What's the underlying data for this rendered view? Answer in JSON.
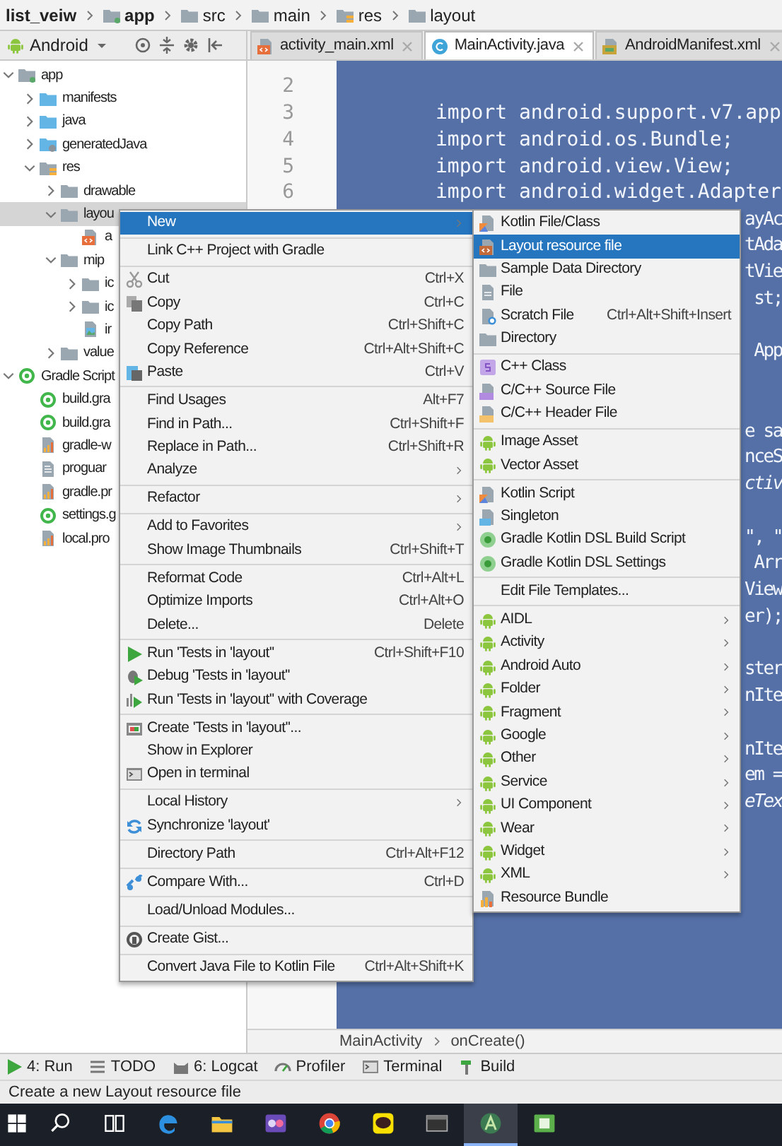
{
  "breadcrumb": [
    {
      "label": "list_veiw",
      "bold": true
    },
    {
      "label": "app",
      "bold": true,
      "kind": "module"
    },
    {
      "label": "src",
      "bold": false,
      "kind": "folder"
    },
    {
      "label": "main",
      "bold": false,
      "kind": "folder"
    },
    {
      "label": "res",
      "bold": false,
      "kind": "res-folder"
    },
    {
      "label": "layout",
      "bold": false,
      "kind": "folder"
    }
  ],
  "project_view": {
    "label": "Android"
  },
  "tabs": [
    {
      "label": "activity_main.xml",
      "kind": "xml",
      "selected": false
    },
    {
      "label": "MainActivity.java",
      "kind": "class",
      "selected": true
    },
    {
      "label": "AndroidManifest.xml",
      "kind": "manifest",
      "selected": false
    }
  ],
  "tree": [
    {
      "label": "app",
      "kind": "module",
      "expanded": true,
      "selected": false,
      "children": [
        {
          "label": "manifests",
          "kind": "folder-blue",
          "expanded": false,
          "selected": false
        },
        {
          "label": "java",
          "kind": "folder-blue",
          "expanded": false,
          "selected": false
        },
        {
          "label": "generatedJava",
          "kind": "folder-gen",
          "expanded": false,
          "selected": false
        },
        {
          "label": "res",
          "kind": "res-folder",
          "expanded": true,
          "selected": false,
          "children": [
            {
              "label": "drawable",
              "kind": "folder",
              "expanded": false,
              "selected": false
            },
            {
              "label": "layou",
              "kind": "folder",
              "expanded": true,
              "selected": true,
              "children": [
                {
                  "label": "a",
                  "kind": "xml",
                  "selected": false
                }
              ]
            },
            {
              "label": "mip",
              "kind": "folder",
              "expanded": true,
              "selected": false,
              "children": [
                {
                  "label": "ic",
                  "kind": "folder",
                  "expanded": false,
                  "selected": false
                },
                {
                  "label": "ic",
                  "kind": "folder",
                  "expanded": false,
                  "selected": false
                },
                {
                  "label": "ir",
                  "kind": "image",
                  "selected": false
                }
              ]
            },
            {
              "label": "value",
              "kind": "folder",
              "expanded": false,
              "selected": false
            }
          ]
        }
      ]
    },
    {
      "label": "Gradle Script",
      "kind": "gradle-ring",
      "expanded": true,
      "selected": false,
      "children": [
        {
          "label": "build.gra",
          "kind": "gradle-ring",
          "selected": false
        },
        {
          "label": "build.gra",
          "kind": "gradle-ring",
          "selected": false
        },
        {
          "label": "gradle-w",
          "kind": "properties",
          "selected": false
        },
        {
          "label": "proguar",
          "kind": "text-file",
          "selected": false
        },
        {
          "label": "gradle.pr",
          "kind": "properties",
          "selected": false
        },
        {
          "label": "settings.g",
          "kind": "gradle-ring",
          "selected": false
        },
        {
          "label": "local.pro",
          "kind": "properties",
          "selected": false
        }
      ]
    }
  ],
  "code_lines": [
    {
      "kind": "full",
      "number": "2"
    },
    {
      "kind": "full",
      "number": "3",
      "text": "import android.support.v7.app"
    },
    {
      "kind": "full",
      "number": "4",
      "text": "import android.os.Bundle;"
    },
    {
      "kind": "full",
      "number": "5",
      "text": "import android.view.View;"
    },
    {
      "kind": "full",
      "number": "6",
      "text": "import android.widget.Adapter"
    },
    {
      "kind": "fragment",
      "text": "ayAc",
      "italic": false
    },
    {
      "kind": "fragment",
      "text": "tAda",
      "italic": false
    },
    {
      "kind": "fragment",
      "text": "tVie",
      "italic": false
    },
    {
      "kind": "fragment",
      "text": "st;",
      "italic": false
    },
    {
      "kind": "blank"
    },
    {
      "kind": "fragment",
      "text": "App",
      "italic": false
    },
    {
      "kind": "blank"
    },
    {
      "kind": "blank"
    },
    {
      "kind": "fragment",
      "text": "e sa",
      "italic": false
    },
    {
      "kind": "fragment",
      "text": "nceS",
      "italic": false
    },
    {
      "kind": "fragment",
      "text": "ctiv",
      "italic": true
    },
    {
      "kind": "blank"
    },
    {
      "kind": "fragment",
      "text": "\", \"",
      "italic": false
    },
    {
      "kind": "fragment",
      "text": "Arr",
      "italic": false
    },
    {
      "kind": "fragment",
      "text": "View",
      "italic": false
    },
    {
      "kind": "fragment",
      "text": "er);",
      "italic": false
    },
    {
      "kind": "blank"
    },
    {
      "kind": "fragment",
      "text": "ster",
      "italic": false
    },
    {
      "kind": "fragment",
      "text": "nIte",
      "italic": false
    },
    {
      "kind": "blank"
    },
    {
      "kind": "fragment",
      "text": "nIte",
      "italic": false
    },
    {
      "kind": "fragment",
      "text": "em =",
      "italic": false
    },
    {
      "kind": "fragment",
      "text": "eTex",
      "italic": true
    }
  ],
  "editor_breadcrumb": [
    "MainActivity",
    "onCreate()"
  ],
  "context_menu": {
    "groups": [
      {
        "items": [
          {
            "label": "New",
            "selected": true,
            "submenu": true
          }
        ]
      },
      {
        "items": [
          {
            "label": "Link C++ Project with Gradle",
            "selected": false,
            "submenu": false
          }
        ]
      },
      {
        "items": [
          {
            "label": "Cut",
            "kind": "scissors",
            "shortcut": "Ctrl+X",
            "selected": false,
            "submenu": false
          },
          {
            "label": "Copy",
            "kind": "copy",
            "shortcut": "Ctrl+C",
            "selected": false,
            "submenu": false
          },
          {
            "label": "Copy Path",
            "shortcut": "Ctrl+Shift+C",
            "selected": false,
            "submenu": false
          },
          {
            "label": "Copy Reference",
            "shortcut": "Ctrl+Alt+Shift+C",
            "selected": false,
            "submenu": false
          },
          {
            "label": "Paste",
            "kind": "paste",
            "shortcut": "Ctrl+V",
            "selected": false,
            "submenu": false
          }
        ]
      },
      {
        "items": [
          {
            "label": "Find Usages",
            "shortcut": "Alt+F7",
            "selected": false,
            "submenu": false
          },
          {
            "label": "Find in Path...",
            "shortcut": "Ctrl+Shift+F",
            "selected": false,
            "submenu": false
          },
          {
            "label": "Replace in Path...",
            "shortcut": "Ctrl+Shift+R",
            "selected": false,
            "submenu": false
          },
          {
            "label": "Analyze",
            "selected": false,
            "submenu": true
          }
        ]
      },
      {
        "items": [
          {
            "label": "Refactor",
            "selected": false,
            "submenu": true
          }
        ]
      },
      {
        "items": [
          {
            "label": "Add to Favorites",
            "selected": false,
            "submenu": true
          },
          {
            "label": "Show Image Thumbnails",
            "shortcut": "Ctrl+Shift+T",
            "selected": false,
            "submenu": false
          }
        ]
      },
      {
        "items": [
          {
            "label": "Reformat Code",
            "shortcut": "Ctrl+Alt+L",
            "selected": false,
            "submenu": false
          },
          {
            "label": "Optimize Imports",
            "shortcut": "Ctrl+Alt+O",
            "selected": false,
            "submenu": false
          },
          {
            "label": "Delete...",
            "shortcut": "Delete",
            "selected": false,
            "submenu": false
          }
        ]
      },
      {
        "items": [
          {
            "label": "Run 'Tests in 'layout''",
            "kind": "run",
            "shortcut": "Ctrl+Shift+F10",
            "selected": false,
            "submenu": false
          },
          {
            "label": "Debug 'Tests in 'layout''",
            "kind": "bug",
            "selected": false,
            "submenu": false
          },
          {
            "label": "Run 'Tests in 'layout'' with Coverage",
            "kind": "coverage",
            "selected": false,
            "submenu": false
          }
        ]
      },
      {
        "items": [
          {
            "label": "Create 'Tests in 'layout''...",
            "kind": "test",
            "selected": false,
            "submenu": false
          },
          {
            "label": "Show in Explorer",
            "selected": false,
            "submenu": false
          },
          {
            "label": "Open in terminal",
            "kind": "terminal",
            "selected": false,
            "submenu": false
          }
        ]
      },
      {
        "items": [
          {
            "label": "Local History",
            "selected": false,
            "submenu": true
          },
          {
            "label": "Synchronize 'layout'",
            "kind": "sync",
            "selected": false,
            "submenu": false
          }
        ]
      },
      {
        "items": [
          {
            "label": "Directory Path",
            "shortcut": "Ctrl+Alt+F12",
            "selected": false,
            "submenu": false
          }
        ]
      },
      {
        "items": [
          {
            "label": "Compare With...",
            "kind": "compare",
            "shortcut": "Ctrl+D",
            "selected": false,
            "submenu": false
          }
        ]
      },
      {
        "items": [
          {
            "label": "Load/Unload Modules...",
            "selected": false,
            "submenu": false
          }
        ]
      },
      {
        "items": [
          {
            "label": "Create Gist...",
            "kind": "gist",
            "selected": false,
            "submenu": false
          }
        ]
      },
      {
        "items": [
          {
            "label": "Convert Java File to Kotlin File",
            "shortcut": "Ctrl+Alt+Shift+K",
            "selected": false,
            "submenu": false
          }
        ]
      }
    ]
  },
  "new_submenu": {
    "groups": [
      {
        "items": [
          {
            "label": "Kotlin File/Class",
            "kind": "kotlin-file",
            "selected": false,
            "submenu": false
          },
          {
            "label": "Layout resource file",
            "kind": "layout-file",
            "selected": true,
            "submenu": false
          },
          {
            "label": "Sample Data Directory",
            "kind": "folder",
            "selected": false,
            "submenu": false
          },
          {
            "label": "File",
            "kind": "file",
            "selected": false,
            "submenu": false
          },
          {
            "label": "Scratch File",
            "kind": "scratch",
            "shortcut": "Ctrl+Alt+Shift+Insert",
            "selected": false,
            "submenu": false
          },
          {
            "label": "Directory",
            "kind": "folder",
            "selected": false,
            "submenu": false
          }
        ]
      },
      {
        "items": [
          {
            "label": "C++ Class",
            "kind": "cpp-class",
            "selected": false,
            "submenu": false
          },
          {
            "label": "C/C++ Source File",
            "kind": "cpp-source",
            "selected": false,
            "submenu": false
          },
          {
            "label": "C/C++ Header File",
            "kind": "cpp-header",
            "selected": false,
            "submenu": false
          }
        ]
      },
      {
        "items": [
          {
            "label": "Image Asset",
            "kind": "android",
            "selected": false,
            "submenu": false
          },
          {
            "label": "Vector Asset",
            "kind": "android",
            "selected": false,
            "submenu": false
          }
        ]
      },
      {
        "items": [
          {
            "label": "Kotlin Script",
            "kind": "kotlin-file",
            "selected": false,
            "submenu": false
          },
          {
            "label": "Singleton",
            "kind": "singleton",
            "selected": false,
            "submenu": false
          },
          {
            "label": "Gradle Kotlin DSL Build Script",
            "kind": "gradle",
            "selected": false,
            "submenu": false
          },
          {
            "label": "Gradle Kotlin DSL Settings",
            "kind": "gradle",
            "selected": false,
            "submenu": false
          }
        ]
      },
      {
        "items": [
          {
            "label": "Edit File Templates...",
            "selected": false,
            "submenu": false
          }
        ]
      },
      {
        "items": [
          {
            "label": "AIDL",
            "kind": "android",
            "selected": false,
            "submenu": true
          },
          {
            "label": "Activity",
            "kind": "android",
            "selected": false,
            "submenu": true
          },
          {
            "label": "Android Auto",
            "kind": "android",
            "selected": false,
            "submenu": true
          },
          {
            "label": "Folder",
            "kind": "android",
            "selected": false,
            "submenu": true
          },
          {
            "label": "Fragment",
            "kind": "android",
            "selected": false,
            "submenu": true
          },
          {
            "label": "Google",
            "kind": "android",
            "selected": false,
            "submenu": true
          },
          {
            "label": "Other",
            "kind": "android",
            "selected": false,
            "submenu": true
          },
          {
            "label": "Service",
            "kind": "android",
            "selected": false,
            "submenu": true
          },
          {
            "label": "UI Component",
            "kind": "android",
            "selected": false,
            "submenu": true
          },
          {
            "label": "Wear",
            "kind": "android",
            "selected": false,
            "submenu": true
          },
          {
            "label": "Widget",
            "kind": "android",
            "selected": false,
            "submenu": true
          },
          {
            "label": "XML",
            "kind": "android",
            "selected": false,
            "submenu": true
          },
          {
            "label": "Resource Bundle",
            "kind": "bundle",
            "selected": false,
            "submenu": false
          }
        ]
      }
    ]
  },
  "tool_windows": [
    {
      "label": "4: Run",
      "kind": "run"
    },
    {
      "label": "TODO",
      "kind": "todo"
    },
    {
      "label": "6: Logcat",
      "kind": "logcat"
    },
    {
      "label": "Profiler",
      "kind": "profiler"
    },
    {
      "label": "Terminal",
      "kind": "terminal"
    },
    {
      "label": "Build",
      "kind": "build"
    }
  ],
  "status_bar": {
    "message": "Create a new Layout resource file"
  },
  "taskbar": [
    {
      "kind": "start",
      "selected": false
    },
    {
      "kind": "search",
      "selected": false
    },
    {
      "kind": "task-view",
      "selected": false
    },
    {
      "kind": "edge",
      "selected": false
    },
    {
      "kind": "explorer",
      "selected": false
    },
    {
      "kind": "purple-app",
      "selected": false
    },
    {
      "kind": "chrome",
      "selected": false
    },
    {
      "kind": "chat",
      "selected": false
    },
    {
      "kind": "dark-app",
      "selected": false
    },
    {
      "kind": "android-studio",
      "selected": true
    },
    {
      "kind": "green-app",
      "selected": false
    }
  ]
}
